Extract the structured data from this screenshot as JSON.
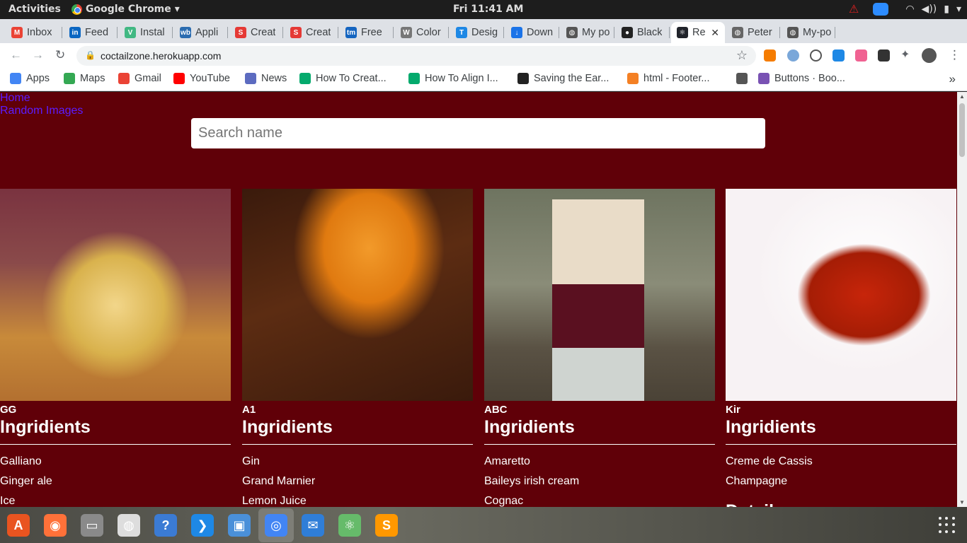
{
  "system_bar": {
    "activities": "Activities",
    "app_name": "Google Chrome",
    "clock": "Fri 11:41 AM"
  },
  "tabs": [
    {
      "label": "Inbox",
      "favicon": "gmail-icon",
      "color": "#ea4335",
      "glyph": "M"
    },
    {
      "label": "Feed",
      "favicon": "linkedin-icon",
      "color": "#0a66c2",
      "glyph": "in"
    },
    {
      "label": "Instal",
      "favicon": "vue-icon",
      "color": "#41b883",
      "glyph": "V"
    },
    {
      "label": "Appli",
      "favicon": "web-icon",
      "color": "#2b6cb0",
      "glyph": "wb"
    },
    {
      "label": "Creat",
      "favicon": "s-icon",
      "color": "#e53935",
      "glyph": "S"
    },
    {
      "label": "Creat",
      "favicon": "s-icon",
      "color": "#e53935",
      "glyph": "S"
    },
    {
      "label": "Free",
      "favicon": "tm-icon",
      "color": "#1565c0",
      "glyph": "tm"
    },
    {
      "label": "Color",
      "favicon": "wordpress-icon",
      "color": "#777777",
      "glyph": "W"
    },
    {
      "label": "Desig",
      "favicon": "t-icon",
      "color": "#1e88e5",
      "glyph": "T"
    },
    {
      "label": "Down",
      "favicon": "download-icon",
      "color": "#1a73e8",
      "glyph": "↓"
    },
    {
      "label": "My po",
      "favicon": "globe-icon",
      "color": "#555555",
      "glyph": "◍"
    },
    {
      "label": "Black",
      "favicon": "github-icon",
      "color": "#222222",
      "glyph": "●"
    },
    {
      "label": "Re",
      "favicon": "react-icon",
      "color": "#20232a",
      "glyph": "⚛",
      "active": true
    },
    {
      "label": "Peter",
      "favicon": "globe-icon",
      "color": "#666666",
      "glyph": "◍"
    },
    {
      "label": "My-po",
      "favicon": "globe-icon",
      "color": "#555555",
      "glyph": "◍"
    }
  ],
  "address_bar": {
    "url": "coctailzone.herokuapp.com"
  },
  "bookmarks": [
    {
      "label": "Apps",
      "icon": "apps-grid-icon",
      "color": "#4285f4"
    },
    {
      "label": "Maps",
      "icon": "maps-pin-icon",
      "color": "#34a853"
    },
    {
      "label": "Gmail",
      "icon": "gmail-icon",
      "color": "#ea4335"
    },
    {
      "label": "YouTube",
      "icon": "youtube-icon",
      "color": "#ff0000"
    },
    {
      "label": "News",
      "icon": "news-icon",
      "color": "#5c6bc0"
    },
    {
      "label": "How To Creat...",
      "icon": "w3schools-icon",
      "color": "#04aa6d"
    },
    {
      "label": "How To Align I...",
      "icon": "w3schools-icon",
      "color": "#04aa6d"
    },
    {
      "label": "Saving the Ear...",
      "icon": "g-icon",
      "color": "#222222"
    },
    {
      "label": "html - Footer...",
      "icon": "stackoverflow-icon",
      "color": "#f48024"
    },
    {
      "label": "",
      "icon": "globe-icon",
      "color": "#555555"
    },
    {
      "label": "Buttons · Boo...",
      "icon": "bootstrap-icon",
      "color": "#7952b3"
    }
  ],
  "page": {
    "nav": {
      "home": "Home",
      "random": "Random Images"
    },
    "search_placeholder": "Search name",
    "ingredients_heading": "Ingridients",
    "details_heading": "Details",
    "background": "#600008",
    "cocktails": [
      {
        "name": "GG",
        "ingredients": [
          "Galliano",
          "Ginger ale",
          "Ice"
        ],
        "image": "glass-tumbler-photo"
      },
      {
        "name": "A1",
        "ingredients": [
          "Gin",
          "Grand Marnier",
          "Lemon Juice"
        ],
        "image": "martini-glass-photo"
      },
      {
        "name": "ABC",
        "ingredients": [
          "Amaretto",
          "Baileys irish cream",
          "Cognac"
        ],
        "image": "shot-glass-photo"
      },
      {
        "name": "Kir",
        "ingredients": [
          "Creme de Cassis",
          "Champagne"
        ],
        "image": "wine-glass-photo"
      }
    ]
  },
  "dock": [
    {
      "name": "software-center-icon",
      "color": "#e95420",
      "glyph": "A"
    },
    {
      "name": "firefox-icon",
      "color": "#ff7139",
      "glyph": "◉"
    },
    {
      "name": "files-icon",
      "color": "#8a8a8a",
      "glyph": "▭"
    },
    {
      "name": "backup-icon",
      "color": "#dddddd",
      "glyph": "◍"
    },
    {
      "name": "help-icon",
      "color": "#3b7bd4",
      "glyph": "?"
    },
    {
      "name": "vscode-icon",
      "color": "#1e88e5",
      "glyph": "❯"
    },
    {
      "name": "image-viewer-icon",
      "color": "#4a90d9",
      "glyph": "▣"
    },
    {
      "name": "chrome-icon",
      "color": "#4285f4",
      "glyph": "◎"
    },
    {
      "name": "mail-icon",
      "color": "#2f7ed8",
      "glyph": "✉"
    },
    {
      "name": "atom-icon",
      "color": "#66bb6a",
      "glyph": "⚛"
    },
    {
      "name": "sublime-icon",
      "color": "#ff9800",
      "glyph": "S"
    }
  ]
}
